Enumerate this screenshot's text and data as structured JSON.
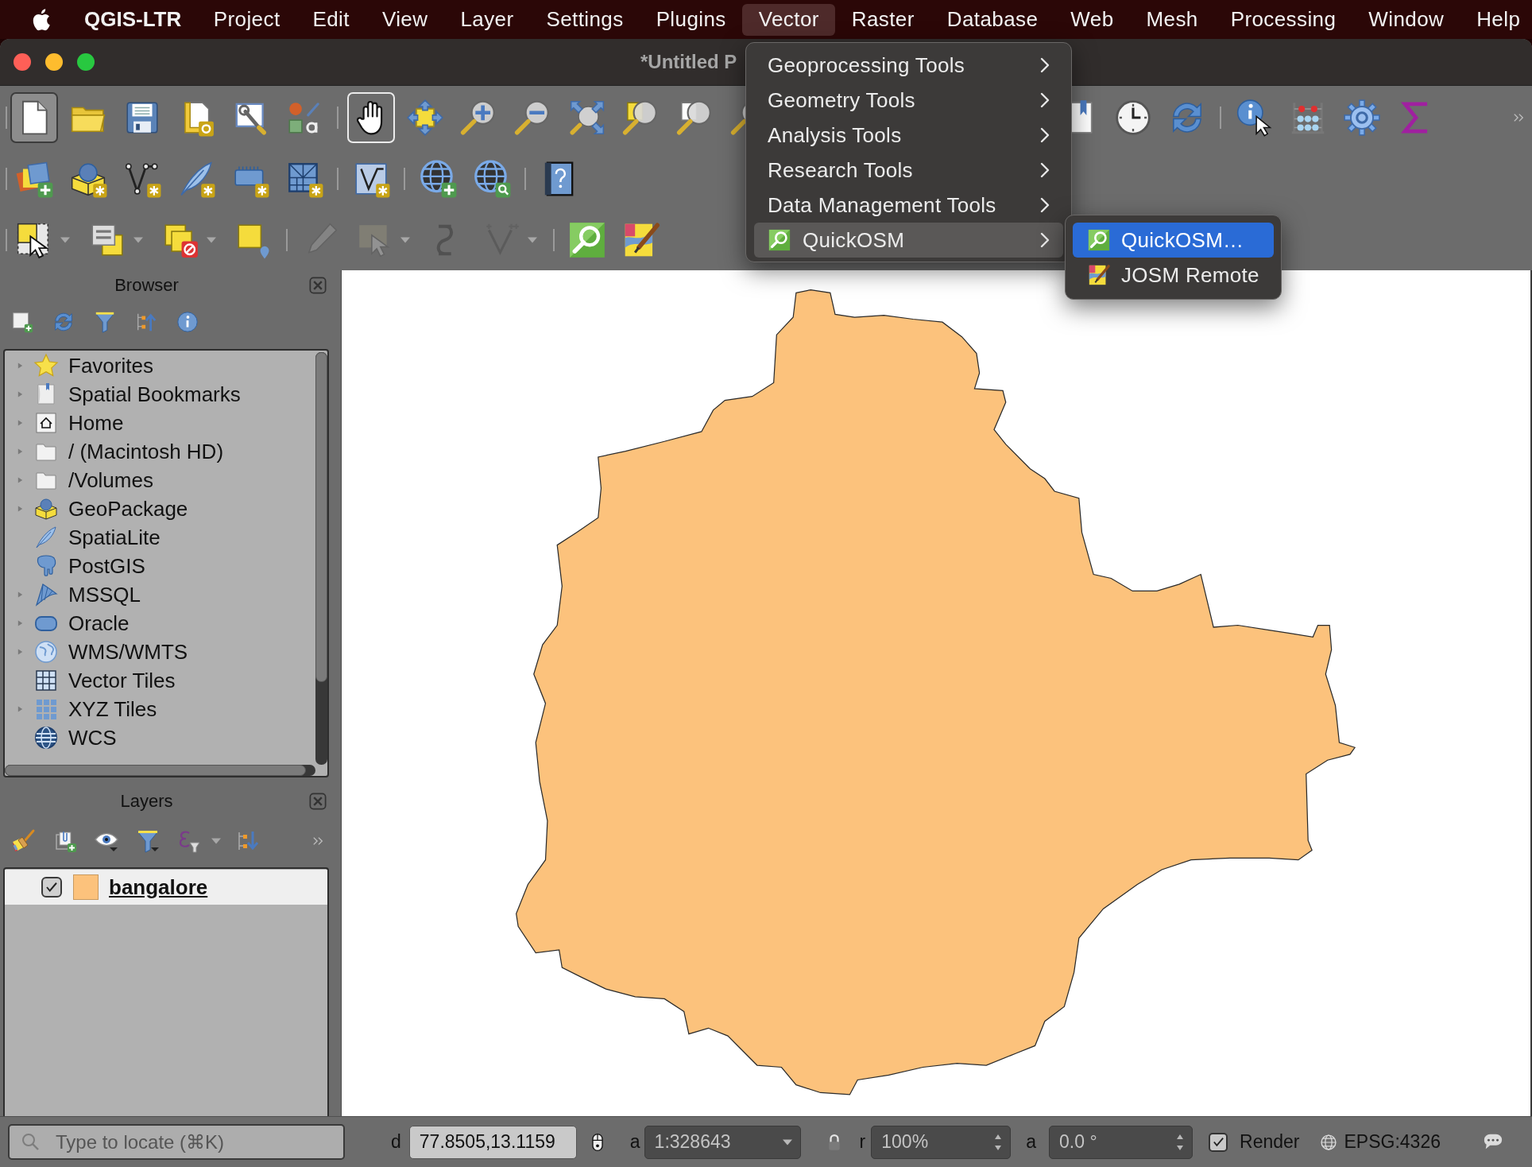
{
  "menu_bar": {
    "app_name": "QGIS-LTR",
    "items": [
      {
        "label": "Project",
        "selected": false
      },
      {
        "label": "Edit",
        "selected": false
      },
      {
        "label": "View",
        "selected": false
      },
      {
        "label": "Layer",
        "selected": false
      },
      {
        "label": "Settings",
        "selected": false
      },
      {
        "label": "Plugins",
        "selected": false
      },
      {
        "label": "Vector",
        "selected": true
      },
      {
        "label": "Raster",
        "selected": false
      },
      {
        "label": "Database",
        "selected": false
      },
      {
        "label": "Web",
        "selected": false
      },
      {
        "label": "Mesh",
        "selected": false
      },
      {
        "label": "Processing",
        "selected": false
      },
      {
        "label": "Window",
        "selected": false
      },
      {
        "label": "Help",
        "selected": false
      }
    ]
  },
  "window": {
    "title": "*Untitled P"
  },
  "toolbars": [
    {
      "groups": [
        [
          {
            "kind": "newproject",
            "hovered": true,
            "selected": false,
            "disabled": false
          },
          {
            "kind": "openproject",
            "hovered": false,
            "selected": false,
            "disabled": false
          },
          {
            "kind": "saveproject",
            "hovered": false,
            "selected": false,
            "disabled": false
          },
          {
            "kind": "newlayout",
            "hovered": false,
            "selected": false,
            "disabled": false
          },
          {
            "kind": "layoutmanager",
            "hovered": false,
            "selected": false,
            "disabled": false
          },
          {
            "kind": "stylemanager",
            "hovered": false,
            "selected": false,
            "disabled": false
          }
        ],
        [
          {
            "kind": "pan",
            "hovered": false,
            "selected": true,
            "disabled": false
          },
          {
            "kind": "pantoselection",
            "hovered": false,
            "selected": false,
            "disabled": false
          },
          {
            "kind": "zoomin",
            "hovered": false,
            "selected": false,
            "disabled": false
          },
          {
            "kind": "zoomout",
            "hovered": false,
            "selected": false,
            "disabled": false
          },
          {
            "kind": "zoomfull",
            "hovered": false,
            "selected": false,
            "disabled": false
          },
          {
            "kind": "zoomselection",
            "hovered": false,
            "selected": false,
            "disabled": false
          },
          {
            "kind": "zoomlayer",
            "hovered": false,
            "selected": false,
            "disabled": false
          },
          {
            "kind": "zoomnative",
            "hovered": false,
            "selected": false,
            "disabled": false
          }
        ]
      ],
      "trailing_groups": [
        [
          {
            "kind": "showbookmarks",
            "hovered": false,
            "selected": false,
            "disabled": false
          },
          {
            "kind": "temporal",
            "hovered": false,
            "selected": false,
            "disabled": false
          },
          {
            "kind": "refresh",
            "hovered": false,
            "selected": false,
            "disabled": false
          }
        ],
        [
          {
            "kind": "identify",
            "hovered": false,
            "selected": false,
            "disabled": false
          },
          {
            "kind": "fieldcalculator",
            "hovered": false,
            "selected": false,
            "disabled": false
          },
          {
            "kind": "toolbox",
            "hovered": false,
            "selected": false,
            "disabled": false
          },
          {
            "kind": "summary",
            "hovered": false,
            "selected": false,
            "disabled": false
          }
        ]
      ],
      "overflow": true
    },
    {
      "groups": [
        [
          {
            "kind": "datasourcemanager",
            "hovered": false,
            "selected": false,
            "disabled": false
          },
          {
            "kind": "newgeopackage",
            "hovered": false,
            "selected": false,
            "disabled": false
          },
          {
            "kind": "newshapefile",
            "hovered": false,
            "selected": false,
            "disabled": false
          },
          {
            "kind": "newspatialite",
            "hovered": false,
            "selected": false,
            "disabled": false
          },
          {
            "kind": "newtemporary",
            "hovered": false,
            "selected": false,
            "disabled": false
          },
          {
            "kind": "newmesh",
            "hovered": false,
            "selected": false,
            "disabled": false
          }
        ],
        [
          {
            "kind": "newvirtual",
            "hovered": false,
            "selected": false,
            "disabled": false
          }
        ],
        [
          {
            "kind": "addservice",
            "hovered": false,
            "selected": false,
            "disabled": false
          },
          {
            "kind": "searchservice",
            "hovered": false,
            "selected": false,
            "disabled": false
          }
        ],
        [
          {
            "kind": "help",
            "hovered": false,
            "selected": false,
            "disabled": false
          }
        ]
      ]
    },
    {
      "groups": [
        [
          {
            "kind": "select",
            "hovered": false,
            "selected": false,
            "disabled": false,
            "dropdown": true
          },
          {
            "kind": "selectattributes",
            "hovered": false,
            "selected": false,
            "disabled": false,
            "dropdown": true
          },
          {
            "kind": "deselect",
            "hovered": false,
            "selected": false,
            "disabled": false,
            "dropdown": true
          },
          {
            "kind": "selectlocation",
            "hovered": false,
            "selected": false,
            "disabled": false
          }
        ],
        [
          {
            "kind": "toggleediting",
            "hovered": false,
            "selected": false,
            "disabled": true
          },
          {
            "kind": "vertextool",
            "hovered": false,
            "selected": false,
            "disabled": true,
            "dropdown": true
          },
          {
            "kind": "digitizecurve",
            "hovered": false,
            "selected": false,
            "disabled": true
          },
          {
            "kind": "digitize",
            "hovered": false,
            "selected": false,
            "disabled": true,
            "dropdown": true
          }
        ],
        [
          {
            "kind": "quickosm",
            "hovered": false,
            "selected": false,
            "disabled": false
          },
          {
            "kind": "josm",
            "hovered": false,
            "selected": false,
            "disabled": false
          }
        ]
      ]
    }
  ],
  "vector_menu": {
    "items": [
      {
        "label": "Geoprocessing Tools",
        "kind": "plain",
        "has_submenu": true,
        "selected": false
      },
      {
        "label": "Geometry Tools",
        "kind": "plain",
        "has_submenu": true,
        "selected": false
      },
      {
        "label": "Analysis Tools",
        "kind": "plain",
        "has_submenu": true,
        "selected": false
      },
      {
        "label": "Research Tools",
        "kind": "plain",
        "has_submenu": true,
        "selected": false
      },
      {
        "label": "Data Management Tools",
        "kind": "plain",
        "has_submenu": true,
        "selected": false
      },
      {
        "label": "QuickOSM",
        "kind": "quickosm",
        "has_submenu": true,
        "selected": true
      }
    ]
  },
  "quickosm_submenu": {
    "items": [
      {
        "label": "QuickOSM…",
        "kind": "quickosm",
        "selected": true
      },
      {
        "label": "JOSM Remote",
        "kind": "josm",
        "selected": false
      }
    ]
  },
  "browser_panel": {
    "title": "Browser",
    "items": [
      {
        "label": "Favorites",
        "kind": "favorites",
        "expanded": false
      },
      {
        "label": "Spatial Bookmarks",
        "kind": "bookmarks",
        "expanded": false
      },
      {
        "label": "Home",
        "kind": "home",
        "expanded": false
      },
      {
        "label": "/ (Macintosh HD)",
        "kind": "folder",
        "expanded": false
      },
      {
        "label": "/Volumes",
        "kind": "folder",
        "expanded": false
      },
      {
        "label": "GeoPackage",
        "kind": "geopackage",
        "expanded": false
      },
      {
        "label": "SpatiaLite",
        "kind": "spatialite"
      },
      {
        "label": "PostGIS",
        "kind": "postgis"
      },
      {
        "label": "MSSQL",
        "kind": "mssql",
        "expanded": false
      },
      {
        "label": "Oracle",
        "kind": "oracle",
        "expanded": false
      },
      {
        "label": "WMS/WMTS",
        "kind": "wms",
        "expanded": false
      },
      {
        "label": "Vector Tiles",
        "kind": "vectortiles"
      },
      {
        "label": "XYZ Tiles",
        "kind": "xyz",
        "expanded": false
      },
      {
        "label": "WCS",
        "kind": "wcs"
      }
    ]
  },
  "layers_panel": {
    "title": "Layers",
    "layers": [
      {
        "name": "bangalore",
        "checked": true,
        "selected": true,
        "color": "#fcc27c"
      }
    ]
  },
  "status_bar": {
    "locator": {
      "placeholder": "Type to locate (⌘K)"
    },
    "coordinate": {
      "label": "d",
      "value": "77.8505,13.1159"
    },
    "scale": {
      "label": "a",
      "value": "1:328643"
    },
    "magnifier": {
      "label": "r",
      "value": "100%"
    },
    "rotation": {
      "label": "a",
      "value": "0.0 °"
    },
    "render": {
      "label": "Render",
      "checked": true
    },
    "crs": "EPSG:4326"
  }
}
